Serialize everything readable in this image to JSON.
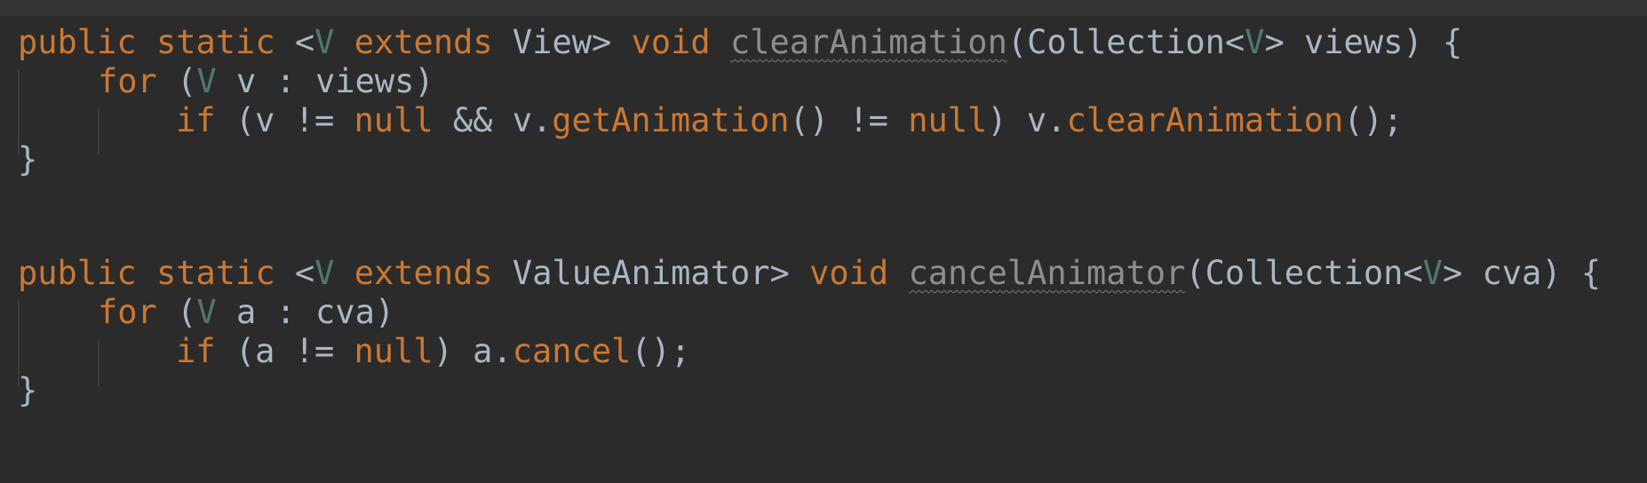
{
  "colors": {
    "background": "#2b2b2b",
    "keyword": "#cc7832",
    "type_param": "#507874",
    "plain": "#a9b7c6",
    "unused_method": "#8e8e8e"
  },
  "code": {
    "line1": {
      "public": "public",
      "static": "static",
      "lt": " <",
      "V": "V",
      "extends": " extends",
      "view": " View>",
      "void": " void",
      "sp": " ",
      "method": "clearAnimation",
      "paren": "(Collection<",
      "V2": "V",
      "rest": "> views) {"
    },
    "line2": {
      "for": "for",
      "open": " (",
      "V": "V",
      "rest": " v : views)"
    },
    "line3": {
      "if": "if",
      "cond1": " (v != ",
      "null1": "null",
      "and": " && v.",
      "getAnim": "getAnimation",
      "neq": "() != ",
      "null2": "null",
      "mid": ") v.",
      "clearAnim": "clearAnimation",
      "end": "();"
    },
    "line4": "}",
    "line5": {
      "public": "public",
      "static": "static",
      "lt": " <",
      "V": "V",
      "extends": " extends",
      "va": " ValueAnimator>",
      "void": " void",
      "sp": " ",
      "method": "cancelAnimator",
      "paren": "(Collection<",
      "V2": "V",
      "rest": "> cva) {"
    },
    "line6": {
      "for": "for",
      "open": " (",
      "V": "V",
      "rest": " a : cva)"
    },
    "line7": {
      "if": "if",
      "cond": " (a != ",
      "null": "null",
      "mid": ") a.",
      "cancel": "cancel",
      "end": "();"
    },
    "line8": "}"
  }
}
